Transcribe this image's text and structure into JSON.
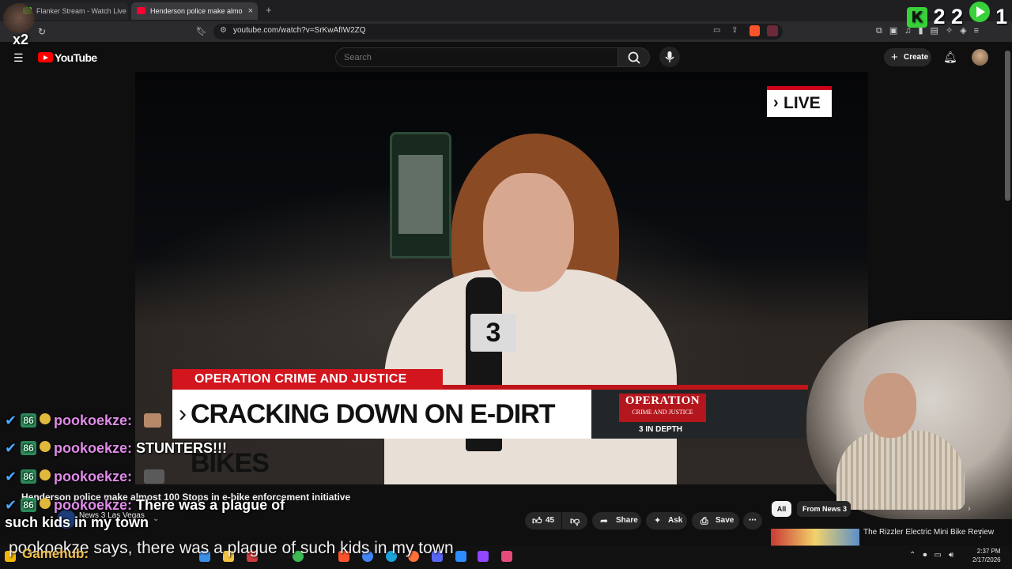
{
  "browser": {
    "tabs": [
      {
        "title": "Flanker Stream - Watch Live on"
      },
      {
        "title": "Henderson police make almo"
      }
    ],
    "url": "youtube.com/watch?v=SrKwAfIW2ZQ"
  },
  "youtube": {
    "logo_text": "YouTube",
    "search_placeholder": "Search",
    "create_label": "Create"
  },
  "video": {
    "live_label": "LIVE",
    "banner_kicker": "OPERATION CRIME AND JUSTICE",
    "banner_headline": "CRACKING DOWN ON E-DIRT BIKES",
    "logo_title": "OPERATION",
    "logo_sub": "CRIME AND JUSTICE",
    "logo_depth": "3 IN DEPTH",
    "mic_flag": "3",
    "title": "Henderson police make almost 100 Stops in e-bike enforcement initiative",
    "channel": "News 3 Las Vegas",
    "actions": {
      "likes": "45",
      "share": "Share",
      "ask": "Ask",
      "save": "Save"
    }
  },
  "recommendations": {
    "chips": [
      "All",
      "From News 3"
    ],
    "items": [
      {
        "title": "The Rizzler Electric Mini Bike Review"
      }
    ]
  },
  "stream_overlay": {
    "counter": "2 2",
    "counter_right": "1",
    "multiplier": "x2",
    "chat": [
      {
        "user": "pookoekze:",
        "message": ""
      },
      {
        "user": "pookoekze:",
        "message": "STUNTERS!!!"
      },
      {
        "user": "pookoekze:",
        "message": ""
      },
      {
        "user": "pookoekze:",
        "message": "There was a plague of such kids in my town"
      }
    ],
    "caption": "pookoekze says, there was a plague of such kids in my town",
    "gamehub": "Gamehub:"
  },
  "taskbar": {
    "time": "2:37 PM",
    "date": "2/17/2026"
  }
}
